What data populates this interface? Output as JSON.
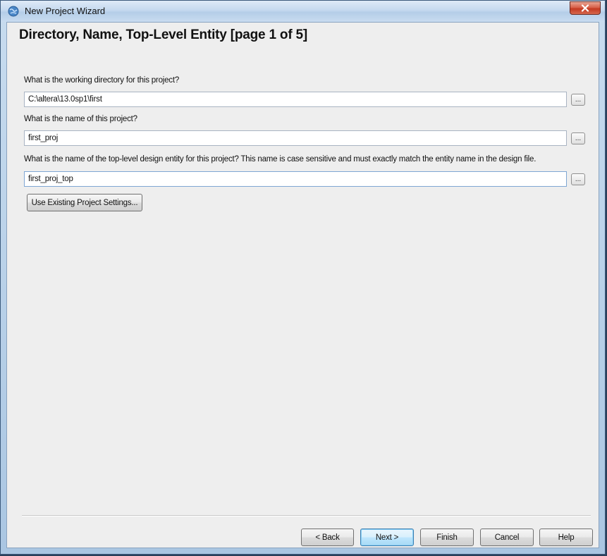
{
  "window": {
    "title": "New Project Wizard",
    "close_label": "x"
  },
  "page": {
    "title": "Directory, Name, Top-Level Entity [page 1 of 5]"
  },
  "fields": [
    {
      "question": "What is the working directory for this project?",
      "value": "C:\\altera\\13.0sp1\\first",
      "browse_label": "..."
    },
    {
      "question": "What is the name of this project?",
      "value": "first_proj",
      "browse_label": "..."
    },
    {
      "question": "What is the name of the top-level design entity for this project? This name is case sensitive and must exactly match the entity name in the design file.",
      "value": "first_proj_top",
      "browse_label": "..."
    }
  ],
  "use_existing_label": "Use Existing Project Settings...",
  "buttons": {
    "back": "< Back",
    "next": "Next >",
    "finish": "Finish",
    "cancel": "Cancel",
    "help": "Help"
  },
  "icons": {
    "title_icon": "quartus-globe-icon",
    "close": "close-icon"
  }
}
